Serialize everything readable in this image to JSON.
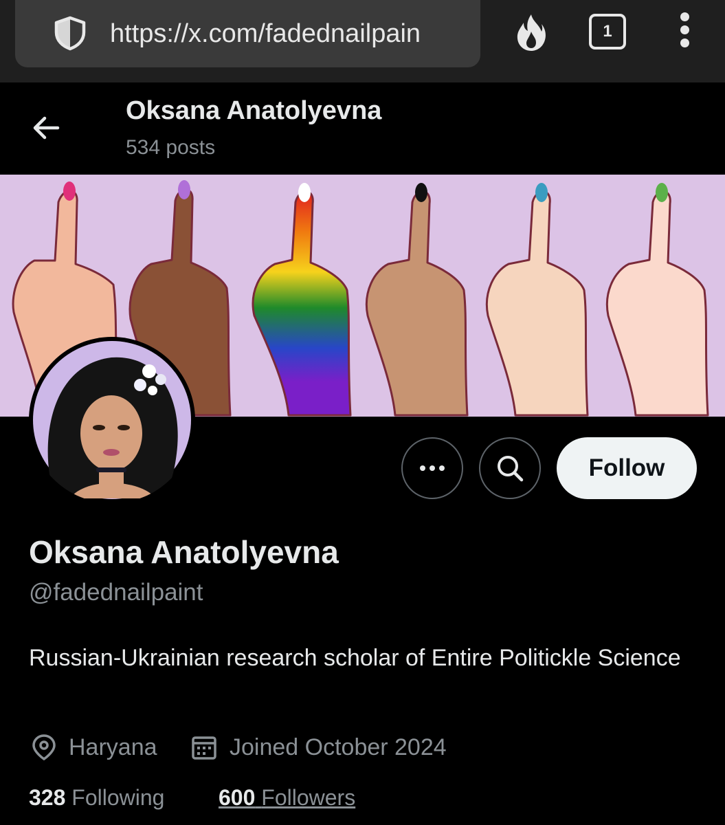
{
  "browser": {
    "url": "https://x.com/fadednailpain",
    "tab_count": "1",
    "icons": [
      "shield-icon",
      "fire-icon",
      "tabs-icon",
      "kebab-menu-icon"
    ]
  },
  "header": {
    "name": "Oksana Anatolyevna",
    "posts": "534 posts"
  },
  "banner": {
    "background_color": "#dcc3e6",
    "description_icons": [
      "back-arrow-icon"
    ]
  },
  "actions": {
    "follow_label": "Follow",
    "more_icon": "more-dots-icon",
    "search_icon": "search-icon"
  },
  "profile": {
    "name": "Oksana Anatolyevna",
    "handle": "@fadednailpaint",
    "bio": "Russian-Ukrainian research scholar of Entire Politickle Science",
    "location": "Haryana",
    "joined": "Joined October 2024",
    "following_count": "328",
    "following_label": "Following",
    "followers_count": "600",
    "followers_label": "Followers"
  },
  "colors": {
    "background": "#000000",
    "text_primary": "#e7e9ea",
    "text_secondary": "#8b9196",
    "follow_button": "#eff3f4"
  }
}
